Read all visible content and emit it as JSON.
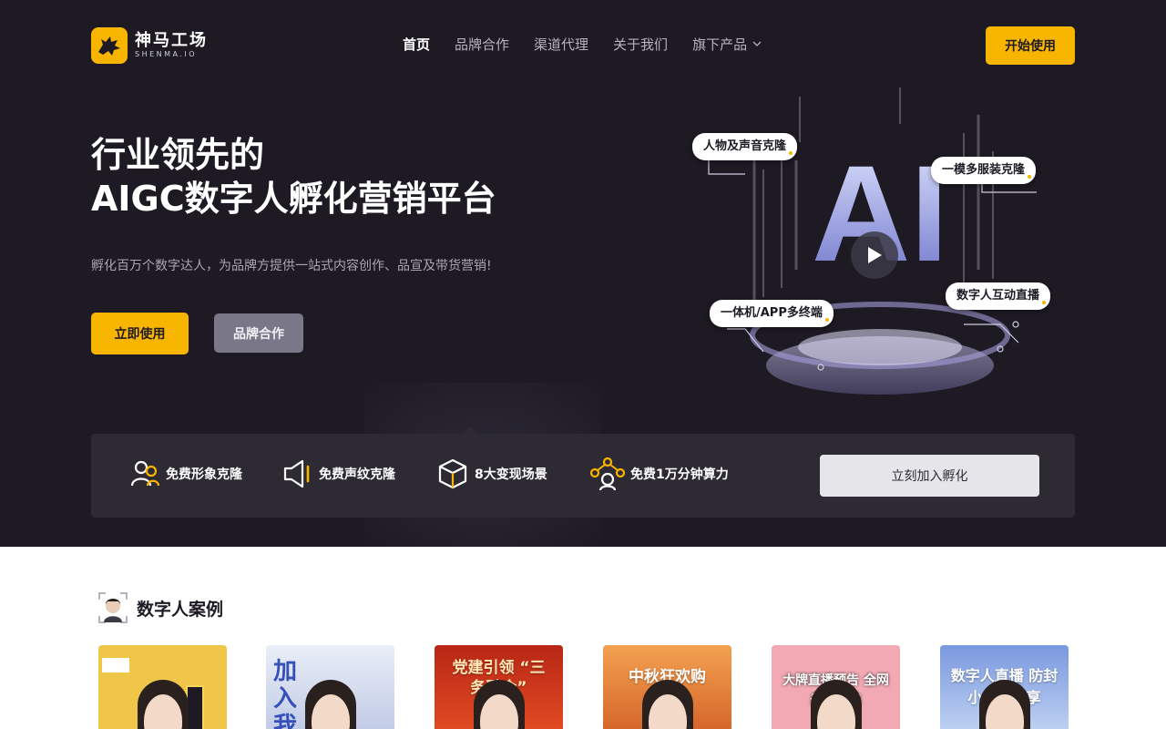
{
  "brand": {
    "name_cn": "神马工场",
    "name_en": "SHENMA.IO"
  },
  "nav": {
    "items": [
      {
        "label": "首页",
        "active": true
      },
      {
        "label": "品牌合作",
        "active": false
      },
      {
        "label": "渠道代理",
        "active": false
      },
      {
        "label": "关于我们",
        "active": false
      },
      {
        "label": "旗下产品",
        "active": false,
        "dropdown": true
      }
    ],
    "cta": "开始使用"
  },
  "hero": {
    "title_line1": "行业领先的",
    "title_line2": "AIGC数字人孵化营销平台",
    "subtitle": "孵化百万个数字达人，为品牌方提供一站式内容创作、品宣及带货营销!",
    "primary_button": "立即使用",
    "secondary_button": "品牌合作",
    "art": {
      "big_text": "AI",
      "tags": [
        "人物及声音克隆",
        "一模多服装克隆",
        "数字人互动直播",
        "一体机/APP多终端"
      ]
    }
  },
  "features": {
    "items": [
      {
        "label": "免费形象克隆",
        "icon": "users-icon"
      },
      {
        "label": "免费声纹克隆",
        "icon": "speaker-icon"
      },
      {
        "label": "8大变现场景",
        "icon": "box-icon"
      },
      {
        "label": "免费1万分钟算力",
        "icon": "network-icon"
      }
    ],
    "join_button": "立刻加入孵化"
  },
  "cases": {
    "title": "数字人案例",
    "cards": [
      {
        "text": "",
        "bg": "#f0c64a"
      },
      {
        "text": "加入 我",
        "bg": "#cfd9ee"
      },
      {
        "text": "党建引领 “三务融合”",
        "bg": "#c9381f"
      },
      {
        "text": "中秋狂欢购",
        "bg": "#e98a3c"
      },
      {
        "text": "大牌直播预告 全网最低折扣",
        "bg": "#f2a9b3"
      },
      {
        "text": "数字人直播 防封小妙招分享",
        "bg": "#6f8fd6"
      }
    ]
  },
  "colors": {
    "accent": "#f7b500",
    "hero_bg": "#1e1a24",
    "feature_bg": "#2d2a33"
  }
}
